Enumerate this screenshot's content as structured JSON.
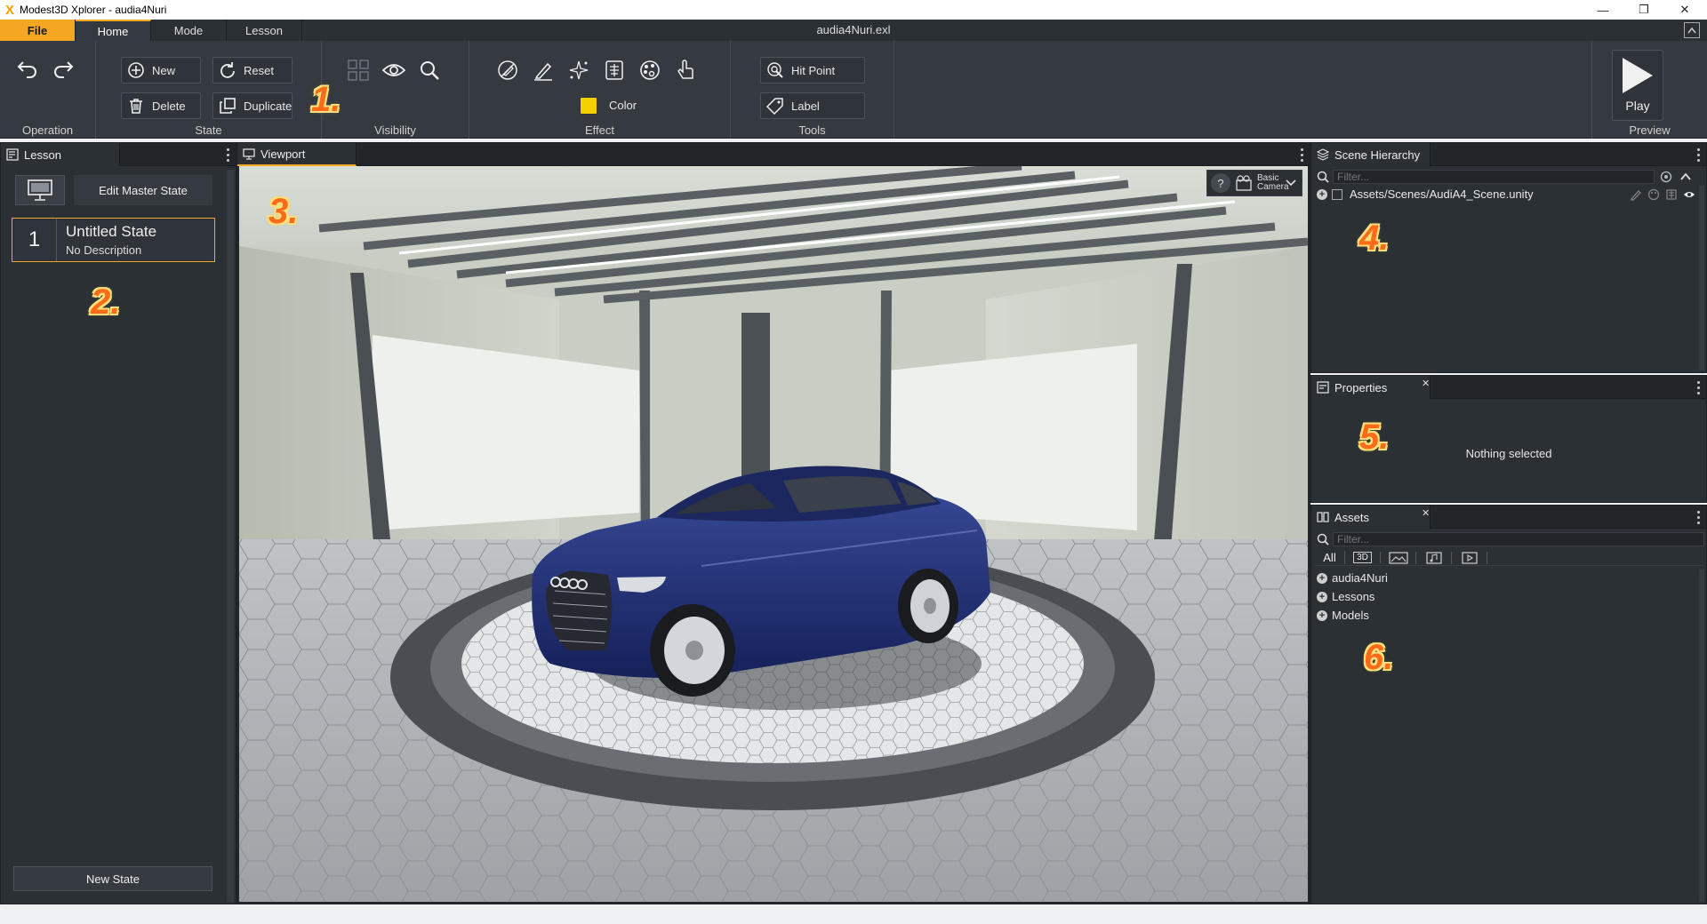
{
  "window": {
    "title": "Modest3D Xplorer - audia4Nuri",
    "doc_title": "audia4Nuri.exl",
    "controls": [
      "—",
      "❐",
      "✕"
    ]
  },
  "menu": {
    "tabs": [
      "File",
      "Home",
      "Mode",
      "Lesson"
    ],
    "active": "Home"
  },
  "ribbon": {
    "groups": {
      "operation": "Operation",
      "state": "State",
      "visibility": "Visibility",
      "effect": "Effect",
      "tools": "Tools",
      "preview": "Preview"
    },
    "state_buttons": {
      "new": "New",
      "reset": "Reset",
      "delete": "Delete",
      "duplicate": "Duplicate"
    },
    "effect_color_label": "Color",
    "effect_color": "#f5d000",
    "tools_buttons": {
      "hit_point": "Hit Point",
      "label": "Label"
    },
    "play_label": "Play"
  },
  "lesson_panel": {
    "tab": "Lesson",
    "edit_master": "Edit Master State",
    "states": [
      {
        "number": "1",
        "title": "Untitled State",
        "description": "No Description"
      }
    ],
    "new_state": "New State"
  },
  "viewport": {
    "tab": "Viewport",
    "camera_label_1": "Basic",
    "camera_label_2": "Camera",
    "help": "?"
  },
  "scene_hierarchy": {
    "tab": "Scene Hierarchy",
    "filter_placeholder": "Filter...",
    "root": "Assets/Scenes/AudiA4_Scene.unity"
  },
  "properties": {
    "tab": "Properties",
    "empty": "Nothing selected"
  },
  "assets": {
    "tab": "Assets",
    "filter_placeholder": "Filter...",
    "filters": [
      "All",
      "3D"
    ],
    "items": [
      "audia4Nuri",
      "Lessons",
      "Models"
    ]
  },
  "annotations": [
    "1.",
    "2.",
    "3.",
    "4.",
    "5.",
    "6."
  ],
  "colors": {
    "accent": "#f5a623",
    "panel": "#2b3035",
    "ribbon": "#343a40",
    "car": "#1e2f6e"
  }
}
